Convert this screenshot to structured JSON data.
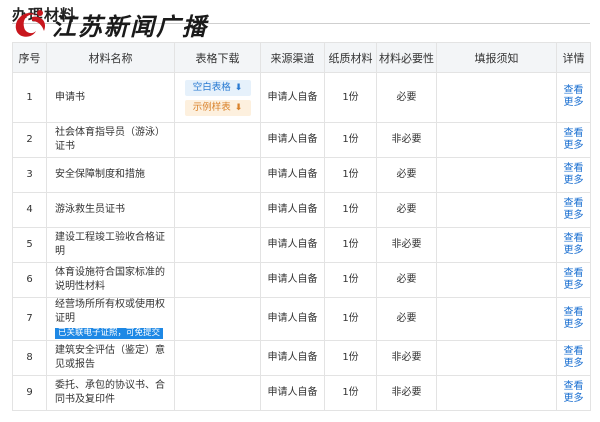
{
  "section": {
    "title": "办理材料"
  },
  "logo": {
    "text": "江苏新闻广播",
    "color": "#c8161d"
  },
  "table": {
    "headers": [
      "序号",
      "材料名称",
      "表格下载",
      "来源渠道",
      "纸质材料",
      "材料必要性",
      "填报须知",
      "详情"
    ],
    "download": {
      "blank_label": "空白表格",
      "sample_label": "示例样表",
      "blank_icon": "download-icon",
      "sample_icon": "download-icon"
    },
    "rows": [
      {
        "no": "1",
        "name": "申请书",
        "source": "申请人自备",
        "paper": "1份",
        "required": "必要",
        "note": "",
        "detail": "查看更多"
      },
      {
        "no": "2",
        "name": "社会体育指导员（游泳）证书",
        "source": "申请人自备",
        "paper": "1份",
        "required": "非必要",
        "note": "",
        "detail": "查看更多"
      },
      {
        "no": "3",
        "name": "安全保障制度和措施",
        "source": "申请人自备",
        "paper": "1份",
        "required": "必要",
        "note": "",
        "detail": "查看更多"
      },
      {
        "no": "4",
        "name": "游泳救生员证书",
        "source": "申请人自备",
        "paper": "1份",
        "required": "必要",
        "note": "",
        "detail": "查看更多"
      },
      {
        "no": "5",
        "name": "建设工程竣工验收合格证明",
        "source": "申请人自备",
        "paper": "1份",
        "required": "非必要",
        "note": "",
        "detail": "查看更多"
      },
      {
        "no": "6",
        "name": "体育设施符合国家标准的说明性材料",
        "source": "申请人自备",
        "paper": "1份",
        "required": "必要",
        "note": "",
        "detail": "查看更多"
      },
      {
        "no": "7",
        "name": "经营场所所有权或使用权证明",
        "tag": "已关联电子证照，可免提交",
        "source": "申请人自备",
        "paper": "1份",
        "required": "必要",
        "note": "",
        "detail": "查看更多"
      },
      {
        "no": "8",
        "name": "建筑安全评估（鉴定）意见或报告",
        "source": "申请人自备",
        "paper": "1份",
        "required": "非必要",
        "note": "",
        "detail": "查看更多"
      },
      {
        "no": "9",
        "name": "委托、承包的协议书、合同书及复印件",
        "source": "申请人自备",
        "paper": "1份",
        "required": "非必要",
        "note": "",
        "detail": "查看更多"
      }
    ]
  }
}
